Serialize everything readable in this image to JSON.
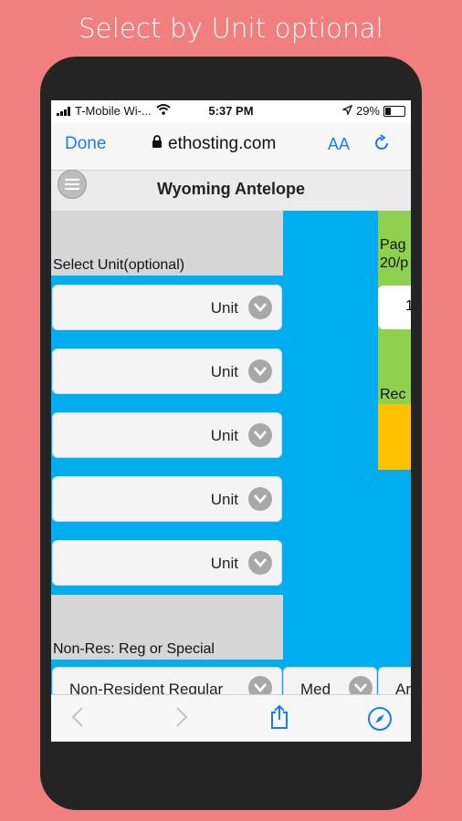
{
  "headline": "Select by Unit optional",
  "status": {
    "carrier": "T-Mobile Wi-...",
    "time": "5:37 PM",
    "battery": "29%",
    "battery_level": 0.29
  },
  "browser": {
    "done_label": "Done",
    "url": "ethosting.com",
    "text_size_label": "AA"
  },
  "app": {
    "title": "Wyoming Antelope"
  },
  "form": {
    "unit_section_label": "Select Unit(optional)",
    "unit_placeholder": "Unit",
    "residency_section_label": "Non-Res: Reg or Special",
    "residency_value": "Non-Resident Regular",
    "method_value": "Med",
    "third_value": "Ar"
  },
  "side_panel": {
    "page_label_line1": "Pag",
    "page_label_line2": "20/p",
    "page_value": "1",
    "rec_label": "Rec"
  },
  "colors": {
    "background": "#f08080",
    "content_blue": "#00aeef",
    "accent_blue": "#1a7cf2",
    "green": "#8fd14f",
    "orange": "#ffc000"
  }
}
